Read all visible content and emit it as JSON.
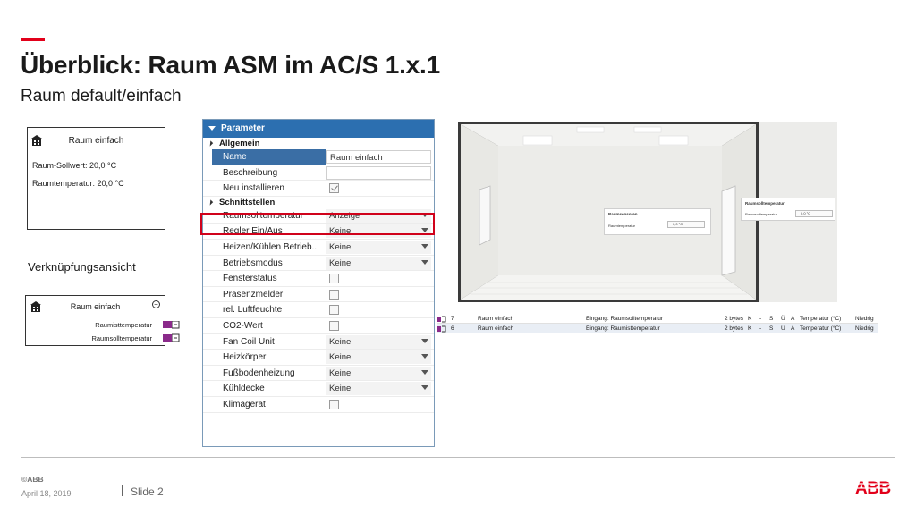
{
  "slide": {
    "title": "Überblick: Raum ASM im AC/S 1.x.1",
    "subtitle": "Raum default/einfach",
    "accent_color": "#e2001a"
  },
  "room_card": {
    "icon": "building-icon",
    "title": "Raum einfach",
    "lines": [
      "Raum-Sollwert: 20,0 °C",
      "Raumtemperatur: 20,0 °C"
    ]
  },
  "link_view": {
    "label": "Verknüpfungsansicht",
    "block_title": "Raum einfach",
    "ports": [
      "Raumisttemperatur",
      "Raumsolltemperatur"
    ],
    "port_color": "#8a2a8a"
  },
  "parameter_panel": {
    "title": "Parameter",
    "header_color": "#2c6fb0",
    "sections": [
      {
        "name": "Allgemein",
        "rows": [
          {
            "label": "Name",
            "type": "text",
            "value": "Raum einfach",
            "selected": true
          },
          {
            "label": "Beschreibung",
            "type": "empty",
            "value": ""
          },
          {
            "label": "Neu installieren",
            "type": "checkbox",
            "checked": true
          }
        ]
      },
      {
        "name": "Schnittstellen",
        "rows": [
          {
            "label": "Raumsolltemperatur",
            "type": "combo",
            "value": "Anzeige",
            "highlighted": true
          },
          {
            "label": "Regler Ein/Aus",
            "type": "combo",
            "value": "Keine"
          },
          {
            "label": "Heizen/Kühlen Betrieb...",
            "type": "combo",
            "value": "Keine"
          },
          {
            "label": "Betriebsmodus",
            "type": "combo",
            "value": "Keine"
          },
          {
            "label": "Fensterstatus",
            "type": "checkbox",
            "checked": false
          },
          {
            "label": "Präsenzmelder",
            "type": "checkbox",
            "checked": false
          },
          {
            "label": "rel. Luftfeuchte",
            "type": "checkbox",
            "checked": false
          },
          {
            "label": "CO2-Wert",
            "type": "checkbox",
            "checked": false
          },
          {
            "label": "Fan Coil Unit",
            "type": "combo",
            "value": "Keine"
          },
          {
            "label": "Heizkörper",
            "type": "combo",
            "value": "Keine"
          },
          {
            "label": "Fußbodenheizung",
            "type": "combo",
            "value": "Keine"
          },
          {
            "label": "Kühldecke",
            "type": "combo",
            "value": "Keine"
          },
          {
            "label": "Klimagerät",
            "type": "checkbox",
            "checked": false
          }
        ]
      }
    ]
  },
  "room_visual": {
    "sensor_box": {
      "title": "Raumsensoren",
      "label": "Raumtemperatur",
      "value": "0,0 °C"
    },
    "setpoint_box": {
      "title": "Raumsolltemperatur",
      "label": "Raumsolltemperatur",
      "value": "0,0 °C"
    }
  },
  "assoc_table": {
    "rows": [
      {
        "num": "7",
        "name": "Raum einfach",
        "function": "Eingang: Raumsolltemperatur",
        "size": "2 bytes",
        "flags": [
          "K",
          "-",
          "S",
          "Ü",
          "A"
        ],
        "dpt": "Temperatur (°C)",
        "prio": "Niedrig"
      },
      {
        "num": "6",
        "name": "Raum einfach",
        "function": "Eingang: Raumisttemperatur",
        "size": "2 bytes",
        "flags": [
          "K",
          "-",
          "S",
          "Ü",
          "A"
        ],
        "dpt": "Temperatur (°C)",
        "prio": "Niedrig"
      }
    ]
  },
  "footer": {
    "copyright": "©ABB",
    "date": "April 18, 2019",
    "slide": "Slide 2",
    "logo": "ABB",
    "logo_color": "#e2001a"
  }
}
